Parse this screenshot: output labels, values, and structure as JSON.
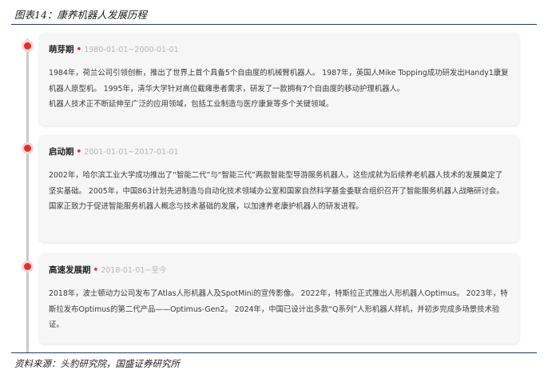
{
  "figure_title": "图表14：康养机器人发展历程",
  "phases": [
    {
      "name": "萌芽期",
      "range": "1980-01-01~2000-01-01",
      "paragraphs": [
        "1984年，荷兰公司引领创新，推出了世界上首个具备5个自由度的机械臂机器人。 1987年，英国人Mike Topping成功研发出Handy1康复机器人原型机。 1995年，清华大学针对高位截瘫患者需求，研发了一款拥有7个自由度的移动护理机器人。",
        "机器人技术正不断延伸至广泛的应用领域，包括工业制造与医疗康复等多个关键领域。"
      ]
    },
    {
      "name": "启动期",
      "range": "2001-01-01~2017-01-01",
      "paragraphs": [
        "2002年，哈尔滨工业大学成功推出了“智能二代”与“智能三代”两款智能型导游服务机器人，这些成就为后续养老机器人技术的发展奠定了坚实基础。 2005年，中国863计划先进制造与自动化技术领域办公室和国家自然科学基金委联合组织召开了智能服务机器人战略研讨会。",
        "国家正致力于促进智能服务机器人概念与技术基础的发展，以加速养老康护机器人的研发进程。"
      ]
    },
    {
      "name": "高速发展期",
      "range": "2018-01-01~至今",
      "paragraphs": [
        "2018年，波士顿动力公司发布了Atlas人形机器人及SpotMini的宣传影像。 2022年，特斯拉正式推出人形机器人Optimus。 2023年，特斯拉发布Optimus的第二代产品——Optimus-Gen2。 2024年，中国已设计出多款“Q系列”人形机器人样机，并初步完成多场景技术验证。"
      ]
    }
  ],
  "separator": "•",
  "source": "资料来源：头豹研究院，国盛证券研究所",
  "colors": {
    "accent": "#e03030",
    "card_bg": "#f6f6f6",
    "rule": "#2a3a5a"
  }
}
